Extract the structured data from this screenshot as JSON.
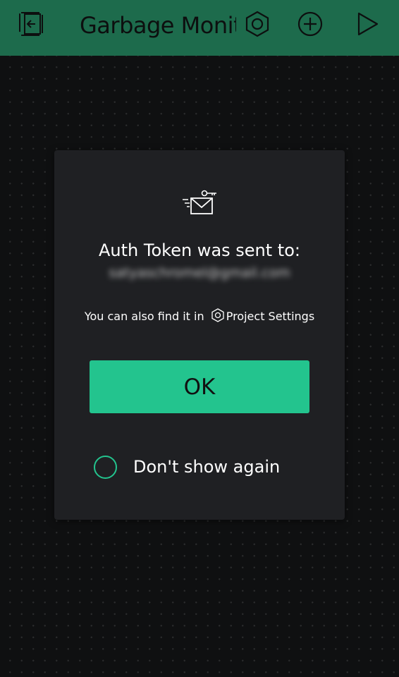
{
  "app": {
    "title": "Garbage Monit",
    "colors": {
      "header": "#1d6b4c",
      "accent": "#23c48e",
      "background": "#151617",
      "dialog": "#1f2023"
    },
    "toolbar": {
      "icons": [
        "exit-icon",
        "settings-hex-icon",
        "add-circle-icon",
        "play-icon"
      ]
    }
  },
  "dialog": {
    "icon": "mail-key-icon",
    "headline": "Auth Token was sent to:",
    "email": "satyaschromel@gmail.com",
    "hint_prefix": "You can also find it in",
    "hint_icon": "settings-hex-icon",
    "hint_link": "Project Settings",
    "ok_label": "OK",
    "dont_show_label": "Don't show again",
    "dont_show_checked": false
  }
}
